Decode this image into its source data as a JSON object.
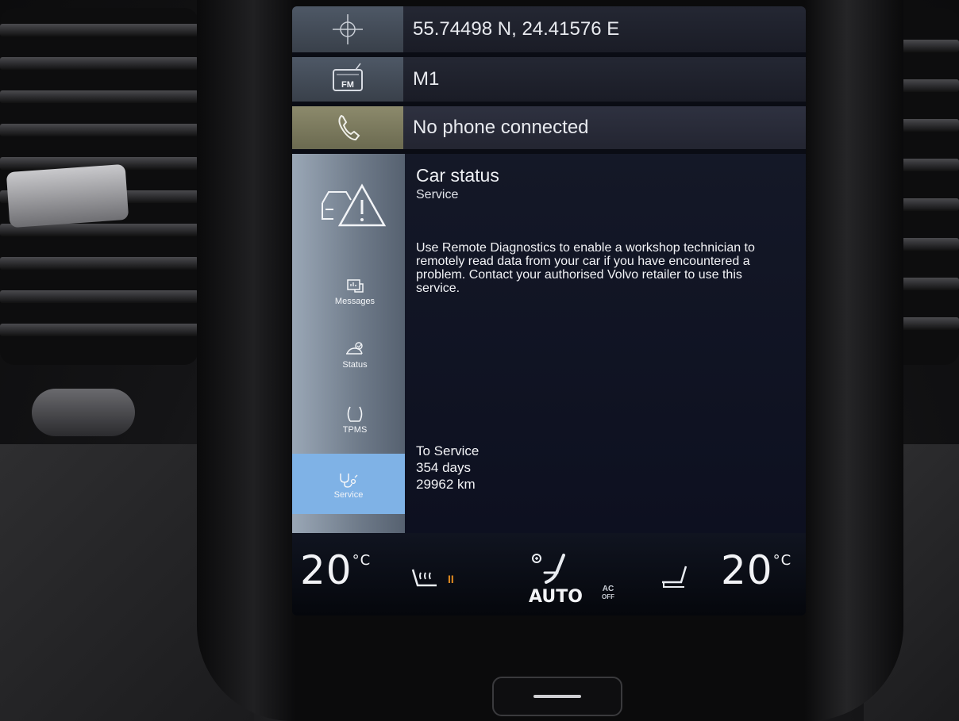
{
  "status_rows": {
    "gps": {
      "icon": "gps-crosshair-icon",
      "text": "55.74498 N, 24.41576 E"
    },
    "radio": {
      "icon": "fm-radio-icon",
      "badge": "FM",
      "text": "M1"
    },
    "phone": {
      "icon": "phone-icon",
      "text": "No phone connected"
    }
  },
  "car_status": {
    "title": "Car status",
    "subtitle": "Service",
    "description": "Use Remote Diagnostics to enable a workshop technician to remotely read data from your car if you have encountered a problem. Contact your authorised Volvo retailer to use this service.",
    "to_service_label": "To Service",
    "days": "354 days",
    "km": "29962 km"
  },
  "sidebar": {
    "items": [
      {
        "label": "Messages",
        "icon": "messages-icon",
        "active": false
      },
      {
        "label": "Status",
        "icon": "car-status-icon",
        "active": false
      },
      {
        "label": "TPMS",
        "icon": "tire-pressure-icon",
        "active": false
      },
      {
        "label": "Service",
        "icon": "service-stethoscope-icon",
        "active": true
      }
    ]
  },
  "climate": {
    "left_temp": "20",
    "right_temp": "20",
    "unit": "°C",
    "seat_heat_level": "II",
    "fan_mode": "AUTO",
    "ac_label": "AC",
    "ac_state": "OFF"
  },
  "colors": {
    "active_tab": "#7fb2e6",
    "phone_row_accent": "#8c8a6c",
    "seat_heat": "#e08a20"
  }
}
